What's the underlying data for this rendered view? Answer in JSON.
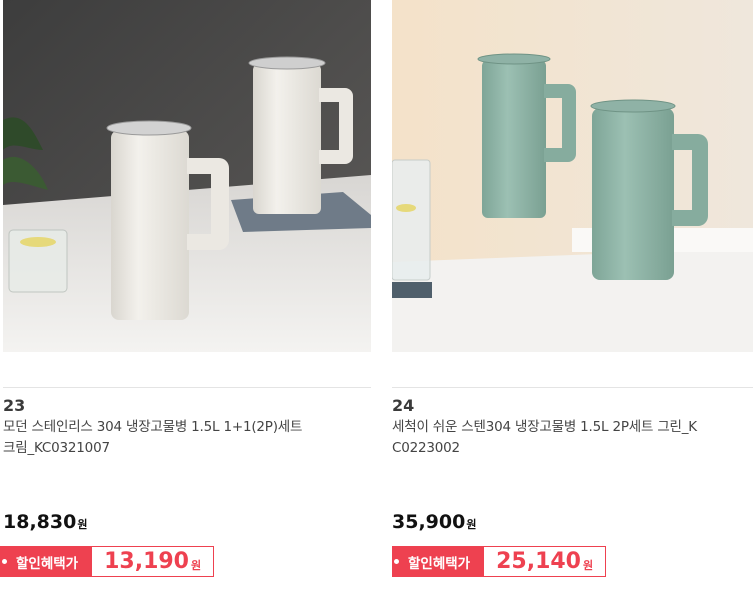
{
  "products": [
    {
      "rank": "23",
      "name_line1": "모던 스테인리스 304 냉장고물병 1.5L 1+1(2P)세트",
      "name_line2": "크림_KC0321007",
      "price": "18,830",
      "price_unit": "원",
      "discount_label": "할인혜택가",
      "discount_price": "13,190",
      "discount_unit": "원",
      "color": "#f1efe9"
    },
    {
      "rank": "24",
      "name_line1": "세척이 쉬운 스텐304 냉장고물병 1.5L 2P세트 그린_K",
      "name_line2": "C0223002",
      "price": "35,900",
      "price_unit": "원",
      "discount_label": "할인혜택가",
      "discount_price": "25,140",
      "discount_unit": "원",
      "color": "#8fb5a8"
    }
  ],
  "accent_color": "#ee4150"
}
